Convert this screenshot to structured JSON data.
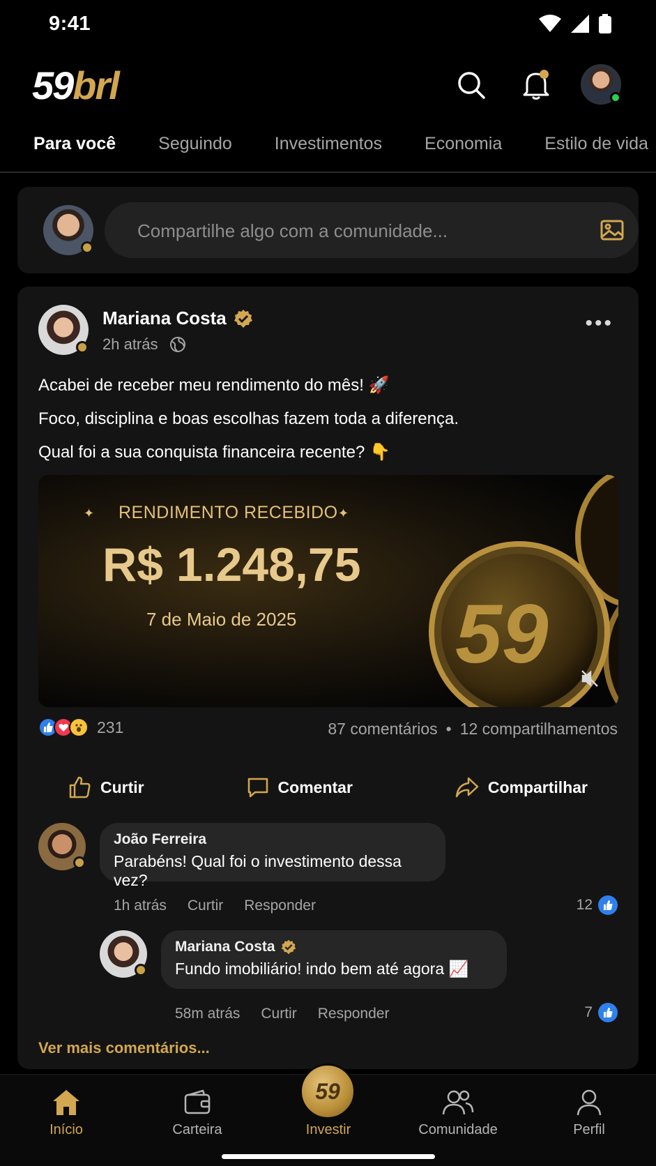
{
  "status_bar": {
    "time": "9:41"
  },
  "header": {
    "logo_num": "59",
    "logo_brl": "brl"
  },
  "tabs": [
    {
      "label": "Para você"
    },
    {
      "label": "Seguindo"
    },
    {
      "label": "Investimentos"
    },
    {
      "label": "Economia"
    },
    {
      "label": "Estilo de vida"
    }
  ],
  "composer": {
    "placeholder": "Compartilhe algo com a comunidade..."
  },
  "post": {
    "author": "Mariana Costa",
    "time": "2h atrás",
    "lines": [
      "Acabei de receber meu rendimento do mês! 🚀",
      "Foco, disciplina e boas escolhas fazem toda a diferença.",
      "Qual foi a sua conquista financeira recente? 👇"
    ],
    "media": {
      "kicker": "RENDIMENTO RECEBIDO",
      "amount": "R$ 1.248,75",
      "date": "7 de Maio de 2025",
      "coin_text": "59"
    },
    "reactions_count": "231",
    "comments_count": "87 comentários",
    "dot": "•",
    "shares_count": "12 compartilhamentos",
    "actions": {
      "like": "Curtir",
      "comment": "Comentar",
      "share": "Compartilhar"
    }
  },
  "comments": [
    {
      "name": "João Ferreira",
      "text": "Parabéns! Qual foi o investimento dessa vez?",
      "time": "1h atrás",
      "like": "Curtir",
      "reply": "Responder",
      "likes": "12"
    },
    {
      "name": "Mariana Costa",
      "text": "Fundo imobiliário! indo bem até agora 📈",
      "time": "58m atrás",
      "like": "Curtir",
      "reply": "Responder",
      "likes": "7"
    }
  ],
  "see_more": "Ver mais comentários...",
  "bottom_nav": {
    "home": "Início",
    "wallet": "Carteira",
    "invest": "Investir",
    "invest_badge": "59",
    "community": "Comunidade",
    "profile": "Perfil"
  },
  "colors": {
    "gold": "#d2a74f",
    "background": "#000000",
    "card": "#141414",
    "like_blue": "#2f80ed"
  }
}
